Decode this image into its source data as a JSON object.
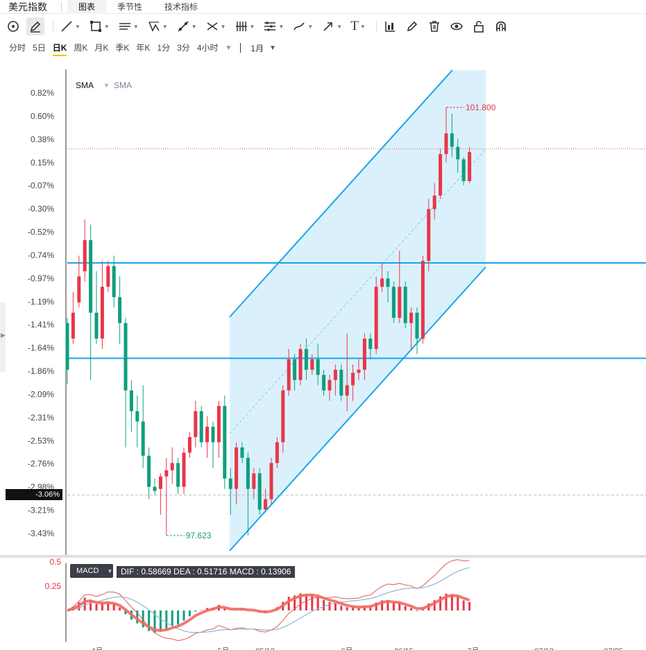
{
  "app": {
    "title": "美元指数"
  },
  "tabs": [
    {
      "label": "图表"
    },
    {
      "label": "季节性"
    },
    {
      "label": "技术指标"
    }
  ],
  "toolbar": {
    "tools": [
      "circle-tool-icon",
      "pencil-icon",
      "trendline-icon",
      "rectangle-icon",
      "parallel-lines-icon",
      "pattern-icon",
      "measure-icon",
      "fibonacci-icon",
      "gann-icon",
      "ruler-icon",
      "brush-icon",
      "arrow-icon",
      "text-icon",
      "bar-chart-icon",
      "edit-icon",
      "trash-icon",
      "eye-icon",
      "lock-icon",
      "magnet-icon"
    ],
    "text_glyph": "T"
  },
  "periods": [
    {
      "label": "分时"
    },
    {
      "label": "5日"
    },
    {
      "label": "日K",
      "active": true
    },
    {
      "label": "周K"
    },
    {
      "label": "月K"
    },
    {
      "label": "季K"
    },
    {
      "label": "年K"
    },
    {
      "label": "1分"
    },
    {
      "label": "3分"
    },
    {
      "label": "4小时"
    }
  ],
  "period_more": "▼",
  "range": {
    "label": "1月",
    "caret": "▼"
  },
  "legend": {
    "sma1": "SMA",
    "sma2": "SMA"
  },
  "current_price_tag": "-3.06%",
  "annotations": {
    "high": "101.800",
    "low": "97.623"
  },
  "macd": {
    "button_label": "MACD",
    "values_text": "DIF : 0.58669   DEA : 0.51716   MACD : 0.13906",
    "y_labels": [
      "0.5",
      "0.25"
    ]
  },
  "colors": {
    "up": "#e8364a",
    "down": "#0e9f7e",
    "channel_line": "#1aa3e8",
    "channel_fill": "#d4effb",
    "dif": "#e05a4f",
    "dea": "#8fb3d9"
  },
  "chart_data": {
    "type": "candlestick",
    "y_axis": {
      "unit": "%",
      "ticks": [
        "0.82%",
        "0.60%",
        "0.38%",
        "0.15%",
        "-0.07%",
        "-0.30%",
        "-0.52%",
        "-0.74%",
        "-0.97%",
        "-1.19%",
        "-1.41%",
        "-1.64%",
        "-1.86%",
        "-2.09%",
        "-2.31%",
        "-2.53%",
        "-2.76%",
        "-2.98%",
        "-3.21%",
        "-3.43%"
      ]
    },
    "x_axis": {
      "ticks": [
        "4月",
        "5月",
        "05/12",
        "6月",
        "06/15",
        "7月",
        "07/12",
        "07/25"
      ]
    },
    "horizontal_lines_pct": [
      -0.82,
      -1.74
    ],
    "reference_line_pct": 0.28,
    "current_line_pct": -3.06,
    "candles": [
      {
        "o": -1.4,
        "c": -1.85,
        "h": -1.35,
        "l": -1.99
      },
      {
        "o": -1.55,
        "c": -1.3,
        "h": -1.1,
        "l": -1.6
      },
      {
        "o": -1.2,
        "c": -0.95,
        "h": -0.75,
        "l": -1.25
      },
      {
        "o": -0.9,
        "c": -0.6,
        "h": -0.4,
        "l": -1.0
      },
      {
        "o": -0.6,
        "c": -1.3,
        "h": -0.45,
        "l": -1.95
      },
      {
        "o": -1.3,
        "c": -1.55,
        "h": -0.9,
        "l": -1.6
      },
      {
        "o": -1.55,
        "c": -1.05,
        "h": -0.8,
        "l": -1.65
      },
      {
        "o": -1.05,
        "c": -0.85,
        "h": -0.8,
        "l": -1.1
      },
      {
        "o": -0.85,
        "c": -1.15,
        "h": -0.75,
        "l": -1.25
      },
      {
        "o": -1.15,
        "c": -1.4,
        "h": -0.95,
        "l": -1.6
      },
      {
        "o": -1.4,
        "c": -2.05,
        "h": -1.35,
        "l": -2.6
      },
      {
        "o": -2.05,
        "c": -2.25,
        "h": -1.95,
        "l": -2.45
      },
      {
        "o": -2.25,
        "c": -2.35,
        "h": -2.1,
        "l": -2.6
      },
      {
        "o": -2.35,
        "c": -2.68,
        "h": -2.0,
        "l": -2.8
      },
      {
        "o": -2.68,
        "c": -2.98,
        "h": -2.6,
        "l": -3.1
      },
      {
        "o": -2.98,
        "c": -3.02,
        "h": -2.9,
        "l": -3.06
      },
      {
        "o": -3.0,
        "c": -2.88,
        "h": -2.85,
        "l": -3.25
      },
      {
        "o": -2.88,
        "c": -2.82,
        "h": -2.7,
        "l": -3.45
      },
      {
        "o": -2.82,
        "c": -2.75,
        "h": -2.6,
        "l": -2.95
      },
      {
        "o": -2.75,
        "c": -2.98,
        "h": -2.7,
        "l": -3.05
      },
      {
        "o": -2.98,
        "c": -2.65,
        "h": -2.6,
        "l": -3.05
      },
      {
        "o": -2.65,
        "c": -2.5,
        "h": -2.45,
        "l": -2.7
      },
      {
        "o": -2.5,
        "c": -2.25,
        "h": -2.15,
        "l": -2.6
      },
      {
        "o": -2.25,
        "c": -2.55,
        "h": -2.2,
        "l": -2.6
      },
      {
        "o": -2.55,
        "c": -2.4,
        "h": -2.3,
        "l": -2.7
      },
      {
        "o": -2.4,
        "c": -2.55,
        "h": -2.35,
        "l": -2.8
      },
      {
        "o": -2.55,
        "c": -2.2,
        "h": -2.15,
        "l": -2.7
      },
      {
        "o": -2.2,
        "c": -2.9,
        "h": -2.1,
        "l": -3.0
      },
      {
        "o": -2.9,
        "c": -3.0,
        "h": -2.8,
        "l": -3.25
      },
      {
        "o": -3.0,
        "c": -2.6,
        "h": -2.55,
        "l": -3.15
      },
      {
        "o": -2.6,
        "c": -2.7,
        "h": -2.55,
        "l": -2.75
      },
      {
        "o": -2.7,
        "c": -3.0,
        "h": -2.65,
        "l": -3.45
      },
      {
        "o": -3.0,
        "c": -2.85,
        "h": -2.8,
        "l": -3.1
      },
      {
        "o": -2.85,
        "c": -3.2,
        "h": -2.8,
        "l": -3.25
      },
      {
        "o": -3.2,
        "c": -3.1,
        "h": -3.0,
        "l": -3.2
      },
      {
        "o": -3.1,
        "c": -2.75,
        "h": -2.7,
        "l": -3.15
      },
      {
        "o": -2.75,
        "c": -2.55,
        "h": -2.5,
        "l": -2.8
      },
      {
        "o": -2.55,
        "c": -2.05,
        "h": -2.0,
        "l": -2.65
      },
      {
        "o": -2.05,
        "c": -1.75,
        "h": -1.65,
        "l": -2.1
      },
      {
        "o": -1.75,
        "c": -1.95,
        "h": -1.7,
        "l": -2.05
      },
      {
        "o": -1.95,
        "c": -1.65,
        "h": -1.6,
        "l": -2.0
      },
      {
        "o": -1.65,
        "c": -1.85,
        "h": -1.55,
        "l": -1.95
      },
      {
        "o": -1.85,
        "c": -1.75,
        "h": -1.7,
        "l": -1.9
      },
      {
        "o": -1.75,
        "c": -1.9,
        "h": -1.6,
        "l": -2.0
      },
      {
        "o": -1.9,
        "c": -2.05,
        "h": -1.85,
        "l": -2.1
      },
      {
        "o": -2.05,
        "c": -1.95,
        "h": -1.9,
        "l": -2.15
      },
      {
        "o": -1.95,
        "c": -1.85,
        "h": -1.8,
        "l": -2.1
      },
      {
        "o": -1.85,
        "c": -2.1,
        "h": -1.8,
        "l": -2.15
      },
      {
        "o": -2.1,
        "c": -2.0,
        "h": -1.5,
        "l": -2.25
      },
      {
        "o": -2.0,
        "c": -1.88,
        "h": -1.8,
        "l": -2.15
      },
      {
        "o": -1.88,
        "c": -1.85,
        "h": -1.75,
        "l": -1.95
      },
      {
        "o": -1.85,
        "c": -1.55,
        "h": -1.5,
        "l": -1.95
      },
      {
        "o": -1.55,
        "c": -1.65,
        "h": -1.5,
        "l": -1.75
      },
      {
        "o": -1.65,
        "c": -1.05,
        "h": -0.95,
        "l": -1.7
      },
      {
        "o": -1.05,
        "c": -0.97,
        "h": -0.82,
        "l": -1.1
      },
      {
        "o": -0.97,
        "c": -1.05,
        "h": -0.9,
        "l": -1.2
      },
      {
        "o": -1.05,
        "c": -1.35,
        "h": -1.0,
        "l": -1.4
      },
      {
        "o": -1.35,
        "c": -1.05,
        "h": -0.7,
        "l": -1.4
      },
      {
        "o": -1.05,
        "c": -1.4,
        "h": -1.0,
        "l": -1.45
      },
      {
        "o": -1.4,
        "c": -1.3,
        "h": -1.25,
        "l": -1.65
      },
      {
        "o": -1.3,
        "c": -1.55,
        "h": -1.25,
        "l": -1.7
      },
      {
        "o": -1.55,
        "c": -0.8,
        "h": -0.75,
        "l": -1.6
      },
      {
        "o": -0.8,
        "c": -0.3,
        "h": -0.2,
        "l": -0.9
      },
      {
        "o": -0.3,
        "c": -0.17,
        "h": -0.05,
        "l": -0.4
      },
      {
        "o": -0.17,
        "c": 0.23,
        "h": 0.28,
        "l": -0.2
      },
      {
        "o": 0.23,
        "c": 0.43,
        "h": 0.68,
        "l": 0.15
      },
      {
        "o": 0.43,
        "c": 0.3,
        "h": 0.62,
        "l": 0.2
      },
      {
        "o": 0.3,
        "c": 0.18,
        "h": 0.38,
        "l": 0.05
      },
      {
        "o": 0.18,
        "c": -0.03,
        "h": 0.2,
        "l": -0.07
      },
      {
        "o": -0.03,
        "c": 0.25,
        "h": 0.3,
        "l": -0.05
      }
    ]
  }
}
